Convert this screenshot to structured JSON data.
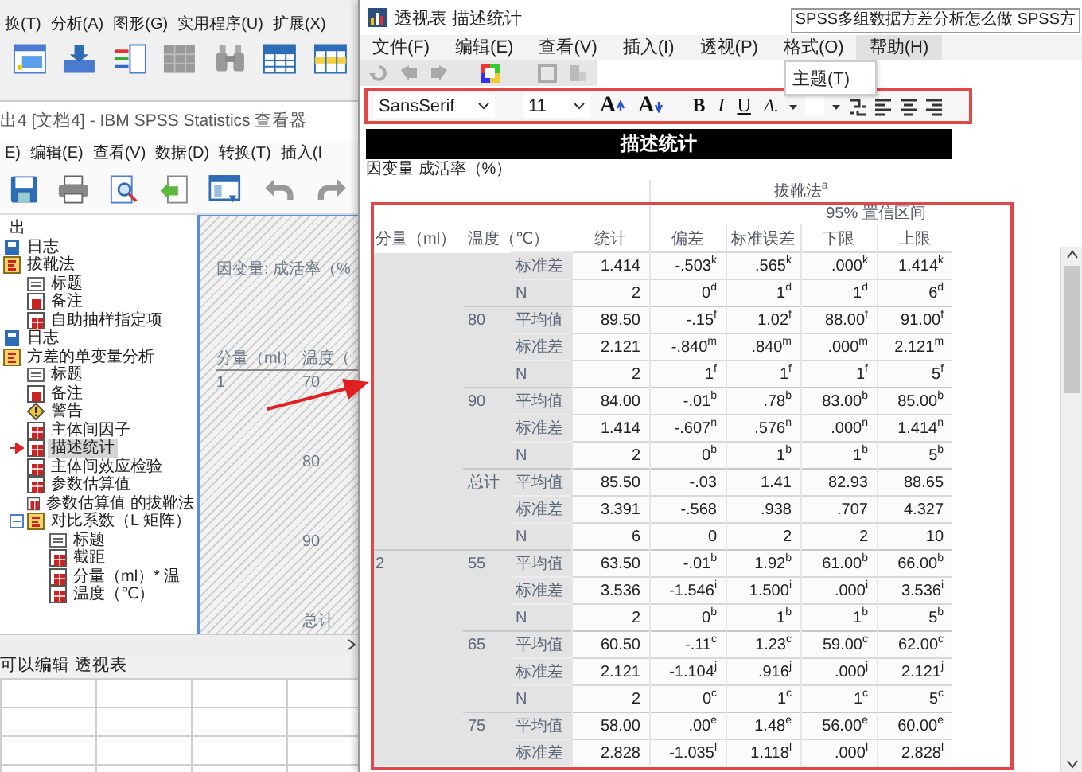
{
  "data_editor": {
    "menu": [
      "换(T)",
      "分析(A)",
      "图形(G)",
      "实用程序(U)",
      "扩展(X)"
    ]
  },
  "viewer": {
    "title": "出4 [文档4] - IBM SPSS Statistics 查看器",
    "menu": [
      "E)",
      "编辑(E)",
      "查看(V)",
      "数据(D)",
      "转换(T)",
      "插入(I"
    ],
    "tree": {
      "label": "出",
      "selected": false,
      "children": [
        {
          "kind": "log",
          "label": "日志",
          "selected": false
        },
        {
          "kind": "folder",
          "label": "拔靴法",
          "selected": false,
          "children": [
            {
              "kind": "title",
              "label": "标题",
              "selected": false
            },
            {
              "kind": "note",
              "label": "备注",
              "selected": false
            },
            {
              "kind": "table",
              "label": "自助抽样指定项",
              "selected": false
            }
          ]
        },
        {
          "kind": "log",
          "label": "日志",
          "selected": false
        },
        {
          "kind": "folder",
          "label": "方差的单变量分析",
          "selected": false,
          "children": [
            {
              "kind": "title",
              "label": "标题",
              "selected": false
            },
            {
              "kind": "note",
              "label": "备注",
              "selected": false
            },
            {
              "kind": "warning",
              "label": "警告",
              "selected": false
            },
            {
              "kind": "table",
              "label": "主体间因子",
              "selected": false
            },
            {
              "kind": "table",
              "label": "描述统计",
              "selected": true
            },
            {
              "kind": "table",
              "label": "主体间效应检验",
              "selected": false
            },
            {
              "kind": "table",
              "label": "参数估算值",
              "selected": false
            },
            {
              "kind": "table",
              "label": "参数估算值 的拔靴法",
              "selected": false
            },
            {
              "kind": "folder",
              "label": "对比系数（L 矩阵）",
              "selected": false,
              "expanded": true,
              "children": [
                {
                  "kind": "title",
                  "label": "标题",
                  "selected": false
                },
                {
                  "kind": "table",
                  "label": "截距",
                  "selected": false
                },
                {
                  "kind": "table",
                  "label": "分量（ml）* 温",
                  "selected": false
                },
                {
                  "kind": "table",
                  "label": "温度（℃）",
                  "selected": false
                }
              ]
            }
          ]
        }
      ]
    },
    "preview": {
      "caption": "因变量:  成活率（%",
      "columns": [
        "分量（ml）",
        "温度（"
      ],
      "rows": [
        [
          "1",
          "70"
        ],
        [
          "",
          "80"
        ],
        [
          "",
          "90"
        ],
        [
          "",
          "总计"
        ]
      ]
    },
    "status_bar": "可以编辑 透视表"
  },
  "tab_tooltip": "SPSS多组数据方差分析怎么做 SPSS方",
  "editor": {
    "title": "透视表 描述统计",
    "menu": [
      {
        "label": "文件(F)",
        "selected": false
      },
      {
        "label": "编辑(E)",
        "selected": false
      },
      {
        "label": "查看(V)",
        "selected": false
      },
      {
        "label": "插入(I)",
        "selected": false
      },
      {
        "label": "透视(P)",
        "selected": false
      },
      {
        "label": "格式(O)",
        "selected": false
      },
      {
        "label": "帮助(H)",
        "selected": true,
        "items": [
          "主题(T)"
        ]
      }
    ],
    "font": "SansSerif",
    "size": "11",
    "format_buttons": [
      {
        "kind": "grow",
        "label": "A"
      },
      {
        "kind": "shrink",
        "label": "A"
      },
      {
        "kind": "bold",
        "label": "B"
      },
      {
        "kind": "italic",
        "label": "I"
      },
      {
        "kind": "underline",
        "label": "U"
      },
      {
        "kind": "text_color",
        "label": "A."
      }
    ],
    "table_title": "描述统计",
    "dependent": "因变量 成活率（%）",
    "table": {
      "spanner": "拔靴法$^{a}$",
      "ci_header": "95% 置信区间",
      "columns": [
        "分量（ml）",
        "温度（℃）",
        "统计",
        "偏差",
        "标准误差",
        "下限",
        "上限"
      ],
      "rows": [
        {
          "stat": "标准差",
          "values": [
            "1.414",
            "-.503$^{k}$",
            ".565$^{k}$",
            ".000$^{k}$",
            "1.414$^{k}$"
          ]
        },
        {
          "stat": "N",
          "values": [
            "2",
            "0$^{d}$",
            "1$^{d}$",
            "1$^{d}$",
            "6$^{d}$"
          ]
        },
        {
          "subgroup": "80",
          "stat": "平均值",
          "values": [
            "89.50",
            "-.15$^{f}$",
            "1.02$^{f}$",
            "88.00$^{f}$",
            "91.00$^{f}$"
          ]
        },
        {
          "stat": "标准差",
          "values": [
            "2.121",
            "-.840$^{m}$",
            ".840$^{m}$",
            ".000$^{m}$",
            "2.121$^{m}$"
          ]
        },
        {
          "stat": "N",
          "values": [
            "2",
            "1$^{f}$",
            "1$^{f}$",
            "1$^{f}$",
            "5$^{f}$"
          ]
        },
        {
          "subgroup": "90",
          "stat": "平均值",
          "values": [
            "84.00",
            "-.01$^{b}$",
            ".78$^{b}$",
            "83.00$^{b}$",
            "85.00$^{b}$"
          ]
        },
        {
          "stat": "标准差",
          "values": [
            "1.414",
            "-.607$^{n}$",
            ".576$^{n}$",
            ".000$^{n}$",
            "1.414$^{n}$"
          ]
        },
        {
          "stat": "N",
          "values": [
            "2",
            "0$^{b}$",
            "1$^{b}$",
            "1$^{b}$",
            "5$^{b}$"
          ]
        },
        {
          "subgroup": "总计",
          "stat": "平均值",
          "values": [
            "85.50",
            "-.03",
            "1.41",
            "82.93",
            "88.65"
          ]
        },
        {
          "stat": "标准差",
          "values": [
            "3.391",
            "-.568",
            ".938",
            ".707",
            "4.327"
          ]
        },
        {
          "stat": "N",
          "values": [
            "6",
            "0",
            "2",
            "2",
            "10"
          ]
        },
        {
          "group": "2",
          "subgroup": "55",
          "stat": "平均值",
          "values": [
            "63.50",
            "-.01$^{b}$",
            "1.92$^{b}$",
            "61.00$^{b}$",
            "66.00$^{b}$"
          ]
        },
        {
          "stat": "标准差",
          "values": [
            "3.536",
            "-1.546$^{i}$",
            "1.500$^{i}$",
            ".000$^{i}$",
            "3.536$^{i}$"
          ]
        },
        {
          "stat": "N",
          "values": [
            "2",
            "0$^{b}$",
            "1$^{b}$",
            "1$^{b}$",
            "5$^{b}$"
          ]
        },
        {
          "subgroup": "65",
          "stat": "平均值",
          "values": [
            "60.50",
            "-.11$^{c}$",
            "1.23$^{c}$",
            "59.00$^{c}$",
            "62.00$^{c}$"
          ]
        },
        {
          "stat": "标准差",
          "values": [
            "2.121",
            "-1.104$^{j}$",
            ".916$^{j}$",
            ".000$^{j}$",
            "2.121$^{j}$"
          ]
        },
        {
          "stat": "N",
          "values": [
            "2",
            "0$^{c}$",
            "1$^{c}$",
            "1$^{c}$",
            "5$^{c}$"
          ]
        },
        {
          "subgroup": "75",
          "stat": "平均值",
          "values": [
            "58.00",
            ".00$^{e}$",
            "1.48$^{e}$",
            "56.00$^{e}$",
            "60.00$^{e}$"
          ]
        },
        {
          "stat": "标准差",
          "values": [
            "2.828",
            "-1.035$^{l}$",
            "1.118$^{l}$",
            ".000$^{l}$",
            "2.828$^{l}$"
          ]
        }
      ]
    }
  }
}
